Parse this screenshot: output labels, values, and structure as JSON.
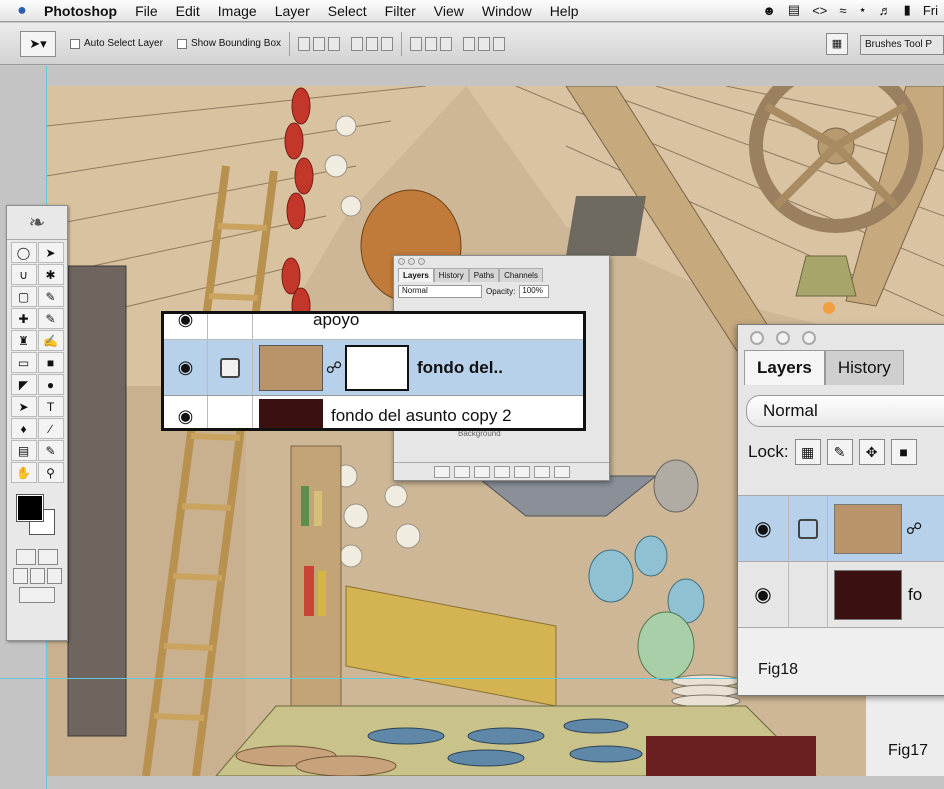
{
  "menubar": {
    "app_name": "Photoshop",
    "items": [
      "File",
      "Edit",
      "Image",
      "Layer",
      "Select",
      "Filter",
      "View",
      "Window",
      "Help"
    ],
    "clock": "Fri"
  },
  "options": {
    "auto_select_label": "Auto Select Layer",
    "bounding_box_label": "Show Bounding Box",
    "palette_well_label": "Brushes Tool P"
  },
  "small_panel": {
    "tabs": [
      "Layers",
      "History",
      "Paths",
      "Channels"
    ],
    "blend_mode": "Normal",
    "opacity_label": "Opacity:",
    "opacity_value": "100%",
    "background_label": "Background"
  },
  "zoom": {
    "top_layer_name": "apoyo",
    "mid_layer_name": "fondo del..",
    "bottom_layer_name": "fondo del asunto copy 2"
  },
  "big_panel": {
    "tabs": [
      "Layers",
      "History"
    ],
    "blend_mode": "Normal",
    "lock_label": "Lock:",
    "layer2_name": "fo",
    "figure_label": "Fig18"
  },
  "figure_label": "Fig17",
  "colors": {
    "guide": "#63c9d8",
    "selected_layer": "#b7d1ea",
    "wall": "#cdb796",
    "roof_wood": "#d9c3a3"
  }
}
